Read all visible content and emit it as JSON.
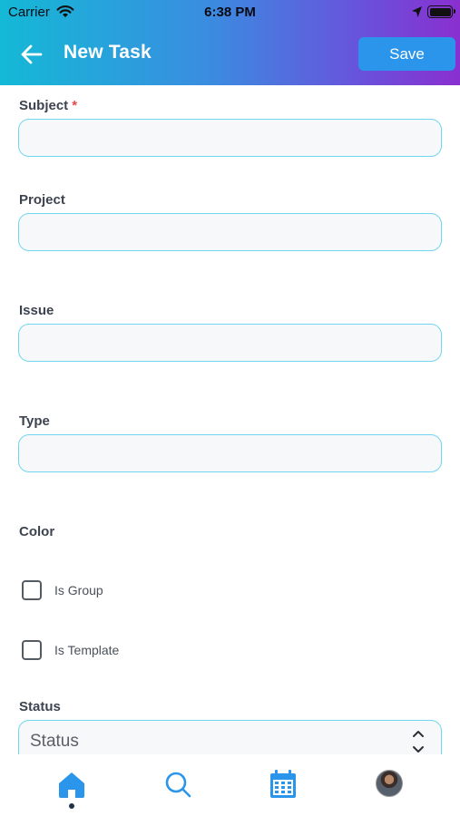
{
  "status_bar": {
    "carrier": "Carrier",
    "time": "6:38 PM"
  },
  "header": {
    "title": "New Task",
    "save_label": "Save"
  },
  "form": {
    "subject": {
      "label": "Subject",
      "required_marker": "*",
      "value": ""
    },
    "project": {
      "label": "Project",
      "value": ""
    },
    "issue": {
      "label": "Issue",
      "value": ""
    },
    "type": {
      "label": "Type",
      "value": ""
    },
    "color": {
      "label": "Color"
    },
    "is_group": {
      "label": "Is Group",
      "checked": false
    },
    "is_template": {
      "label": "Is Template",
      "checked": false
    },
    "status": {
      "label": "Status",
      "placeholder": "Status"
    }
  },
  "tabbar": {
    "items": [
      {
        "icon": "home-icon",
        "active": true
      },
      {
        "icon": "search-icon",
        "active": false
      },
      {
        "icon": "calendar-icon",
        "active": false
      },
      {
        "icon": "avatar",
        "active": false
      }
    ]
  },
  "colors": {
    "accent": "#2a95ea",
    "field_border": "#6fd6ee",
    "gradient_start": "#14b9d6",
    "gradient_end": "#8a2fd0"
  }
}
